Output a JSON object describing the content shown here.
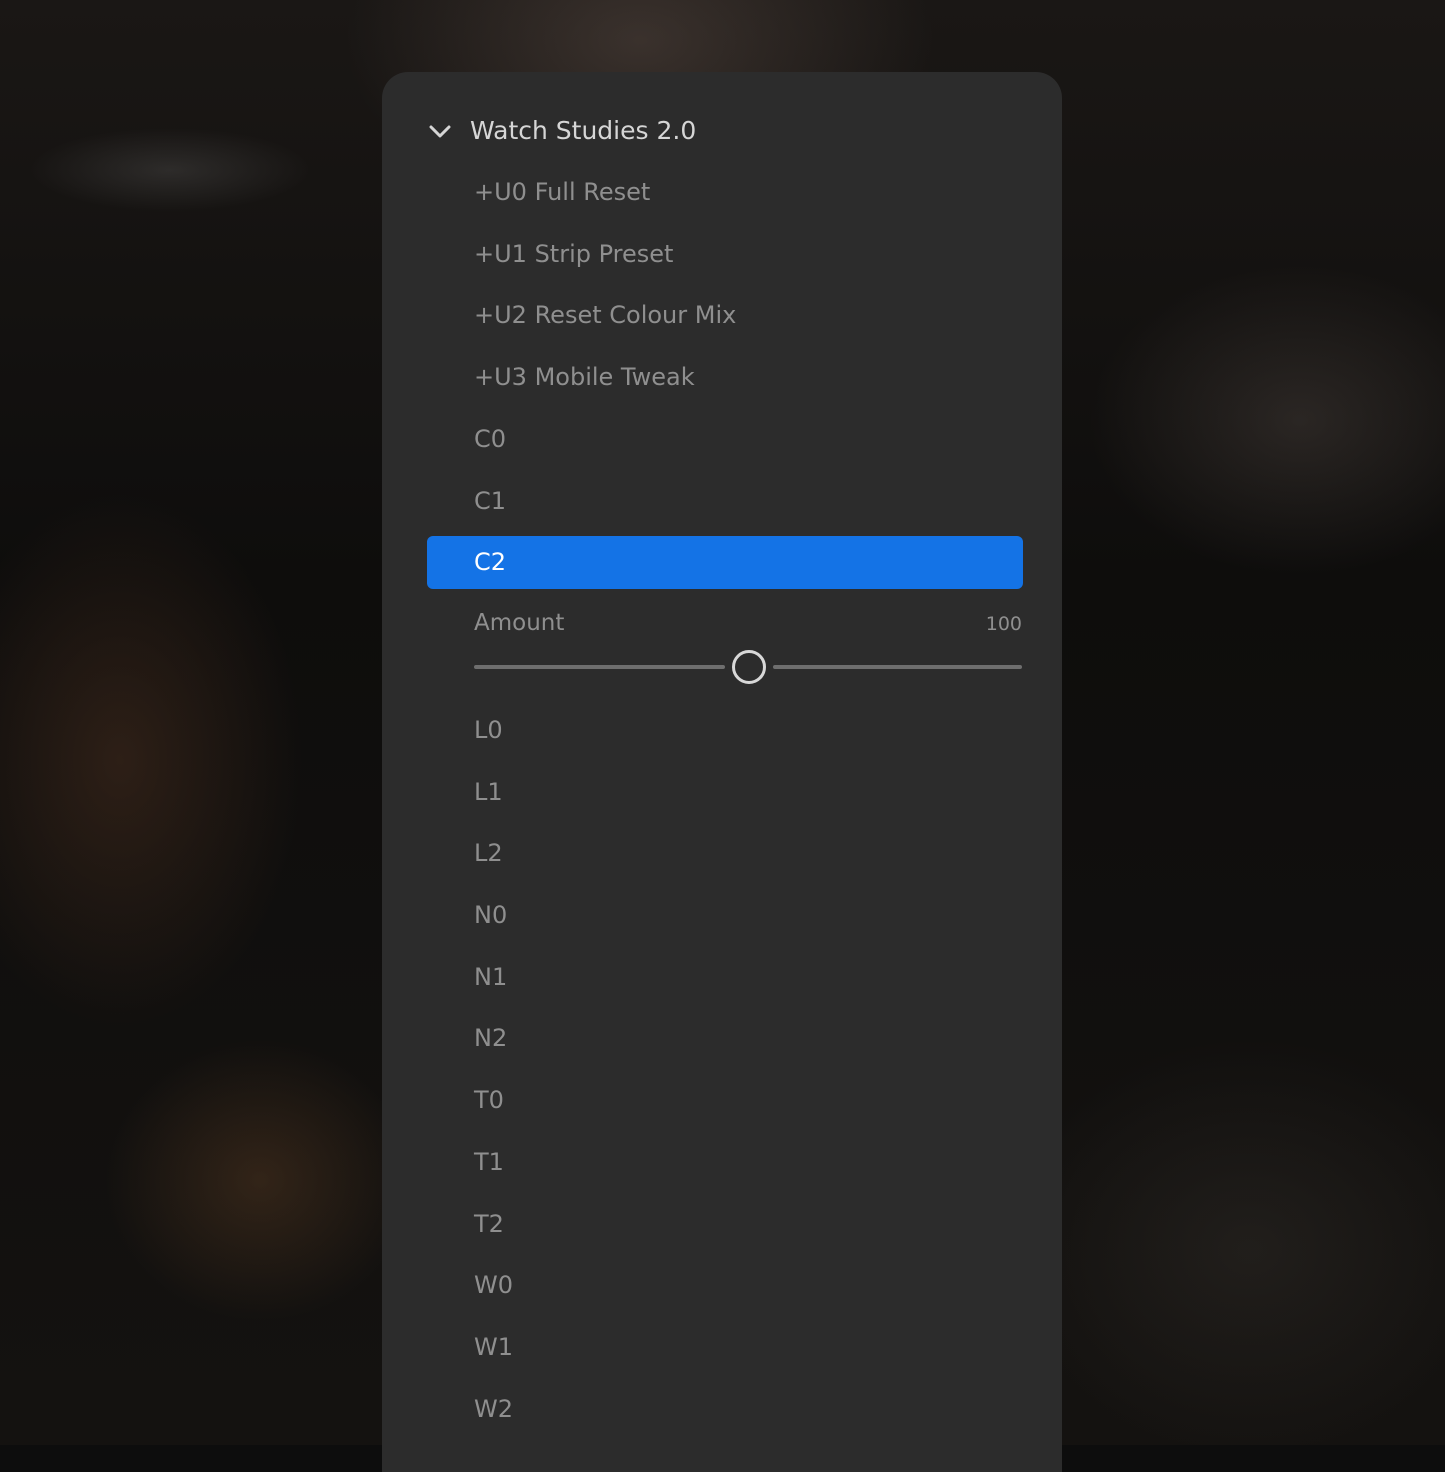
{
  "group": {
    "title": "Watch Studies 2.0",
    "expanded": true,
    "chevron_icon": "chevron-down-icon"
  },
  "presets": [
    {
      "label": "+U0 Full Reset",
      "selected": false
    },
    {
      "label": "+U1 Strip Preset",
      "selected": false
    },
    {
      "label": "+U2 Reset Colour Mix",
      "selected": false
    },
    {
      "label": "+U3 Mobile Tweak",
      "selected": false
    },
    {
      "label": "C0",
      "selected": false
    },
    {
      "label": "C1",
      "selected": false
    },
    {
      "label": "C2",
      "selected": true
    },
    {
      "label": "L0",
      "selected": false
    },
    {
      "label": "L1",
      "selected": false
    },
    {
      "label": "L2",
      "selected": false
    },
    {
      "label": "N0",
      "selected": false
    },
    {
      "label": "N1",
      "selected": false
    },
    {
      "label": "N2",
      "selected": false
    },
    {
      "label": "T0",
      "selected": false
    },
    {
      "label": "T1",
      "selected": false
    },
    {
      "label": "T2",
      "selected": false
    },
    {
      "label": "W0",
      "selected": false
    },
    {
      "label": "W1",
      "selected": false
    },
    {
      "label": "W2",
      "selected": false
    }
  ],
  "amount": {
    "label": "Amount",
    "value_text": "100",
    "value": 100,
    "min": 0,
    "max": 200
  },
  "colors": {
    "panel": "#2c2c2c",
    "selected": "#1473e6",
    "text": "#8f8f8f",
    "title": "#d6d6d6"
  }
}
